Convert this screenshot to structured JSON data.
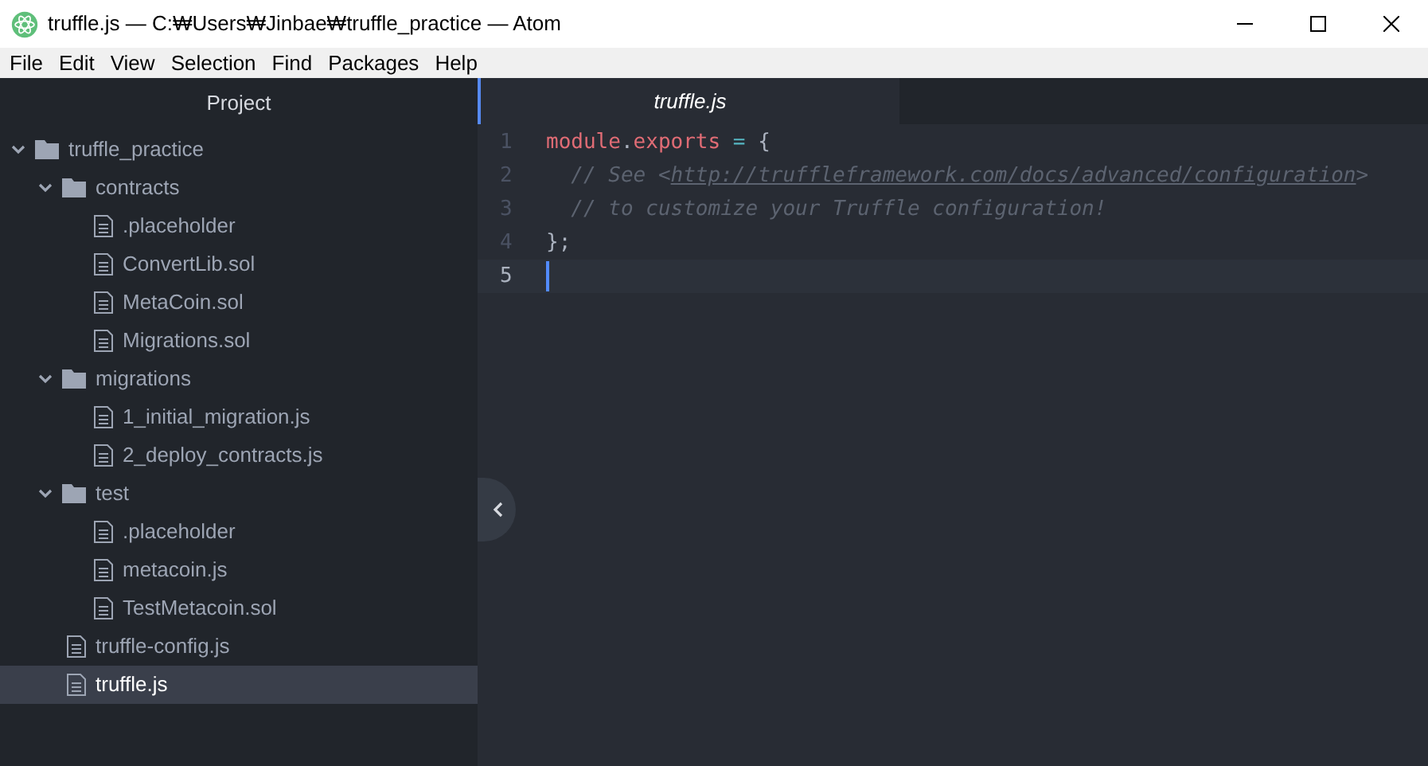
{
  "window": {
    "title": "truffle.js — C:₩Users₩Jinbae₩truffle_practice — Atom"
  },
  "menu": [
    "File",
    "Edit",
    "View",
    "Selection",
    "Find",
    "Packages",
    "Help"
  ],
  "sidebar": {
    "title": "Project",
    "tree": [
      {
        "kind": "folder",
        "name": "truffle_practice",
        "expanded": true,
        "selected": false,
        "children": [
          {
            "kind": "folder",
            "name": "contracts",
            "expanded": true,
            "selected": false,
            "children": [
              {
                "kind": "file",
                "name": ".placeholder",
                "selected": false
              },
              {
                "kind": "file",
                "name": "ConvertLib.sol",
                "selected": false
              },
              {
                "kind": "file",
                "name": "MetaCoin.sol",
                "selected": false
              },
              {
                "kind": "file",
                "name": "Migrations.sol",
                "selected": false
              }
            ]
          },
          {
            "kind": "folder",
            "name": "migrations",
            "expanded": true,
            "selected": false,
            "children": [
              {
                "kind": "file",
                "name": "1_initial_migration.js",
                "selected": false
              },
              {
                "kind": "file",
                "name": "2_deploy_contracts.js",
                "selected": false
              }
            ]
          },
          {
            "kind": "folder",
            "name": "test",
            "expanded": true,
            "selected": false,
            "children": [
              {
                "kind": "file",
                "name": ".placeholder",
                "selected": false
              },
              {
                "kind": "file",
                "name": "metacoin.js",
                "selected": false
              },
              {
                "kind": "file",
                "name": "TestMetacoin.sol",
                "selected": false
              }
            ]
          },
          {
            "kind": "file",
            "name": "truffle-config.js",
            "selected": false
          },
          {
            "kind": "file",
            "name": "truffle.js",
            "selected": true
          }
        ]
      }
    ]
  },
  "tabs": [
    {
      "label": "truffle.js",
      "selected": true
    }
  ],
  "editor": {
    "lines": [
      {
        "number": "1",
        "current": false,
        "tokens": [
          {
            "kind": "variable",
            "text": "module"
          },
          {
            "kind": "punct",
            "text": "."
          },
          {
            "kind": "variable",
            "text": "exports"
          },
          {
            "kind": "operator",
            "text": " = "
          },
          {
            "kind": "punct",
            "text": "{"
          }
        ]
      },
      {
        "number": "2",
        "current": false,
        "tokens": [
          {
            "kind": "comment",
            "text": "  // See <"
          },
          {
            "kind": "link",
            "text": "http://truffleframework.com/docs/advanced/configuration"
          },
          {
            "kind": "comment",
            "text": ">"
          }
        ]
      },
      {
        "number": "3",
        "current": false,
        "tokens": [
          {
            "kind": "comment",
            "text": "  // to customize your Truffle configuration!"
          }
        ]
      },
      {
        "number": "4",
        "current": false,
        "tokens": [
          {
            "kind": "punct",
            "text": "};"
          }
        ]
      },
      {
        "number": "5",
        "current": true
      }
    ]
  }
}
